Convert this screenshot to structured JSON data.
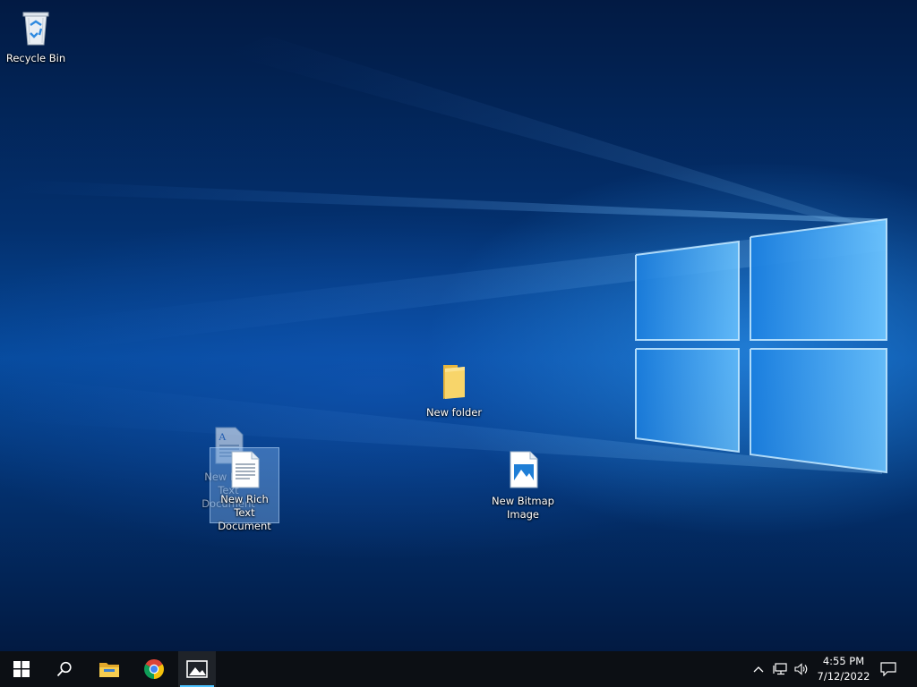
{
  "desktop": {
    "icons": [
      {
        "name": "recycle-bin",
        "label": "Recycle Bin"
      },
      {
        "name": "new-folder",
        "label": "New folder"
      },
      {
        "name": "new-bitmap-image",
        "label": "New Bitmap Image"
      },
      {
        "name": "new-rich-text-document",
        "label": "New Rich Text Document",
        "selected": true
      },
      {
        "name": "new-rich-text-document-drag-ghost",
        "label": "New Rich Text Document"
      }
    ]
  },
  "taskbar": {
    "items": [
      {
        "name": "start",
        "icon": "windows-logo-icon"
      },
      {
        "name": "search",
        "icon": "search-icon"
      },
      {
        "name": "file-explorer",
        "icon": "folder-icon"
      },
      {
        "name": "chrome",
        "icon": "chrome-icon"
      },
      {
        "name": "photos",
        "icon": "image-icon",
        "active": true
      }
    ],
    "tray": {
      "icons": [
        "chevron-up-icon",
        "network-icon",
        "volume-icon"
      ],
      "time": "4:55 PM",
      "date": "7/12/2022",
      "notification_icon": "action-center-icon"
    },
    "accent_color": "#4cc2ff"
  }
}
